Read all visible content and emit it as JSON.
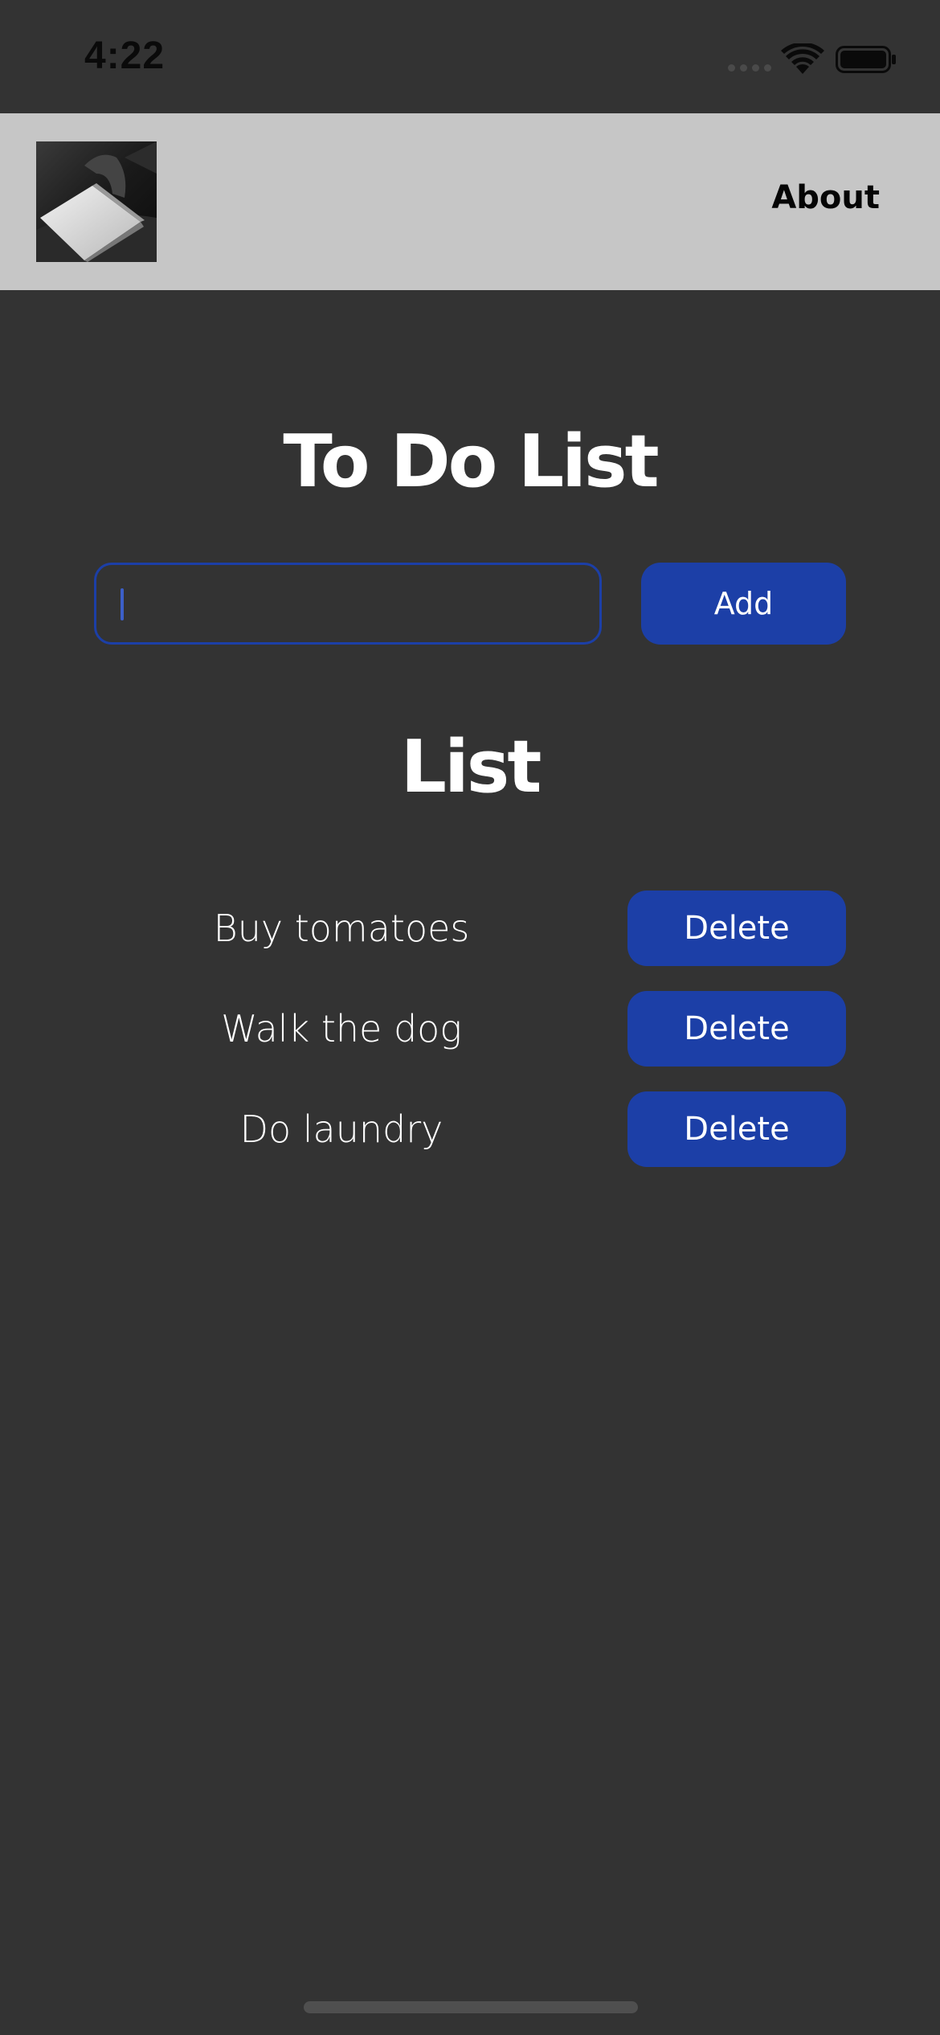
{
  "status_bar": {
    "time": "4:22",
    "icons": [
      "signal-icon",
      "wifi-icon",
      "battery-icon"
    ]
  },
  "nav": {
    "logo": "notebook-photo",
    "about_label": "About",
    "background": "#c6c6c6"
  },
  "main": {
    "title": "To Do List",
    "input": {
      "value": "",
      "placeholder": ""
    },
    "add_label": "Add",
    "list_heading": "List",
    "items": [
      {
        "text": "Buy tomatoes",
        "delete_label": "Delete"
      },
      {
        "text": "Walk the dog",
        "delete_label": "Delete"
      },
      {
        "text": "Do laundry",
        "delete_label": "Delete"
      }
    ]
  },
  "colors": {
    "background": "#333333",
    "accent": "#1c3fa7",
    "text": "#ffffff"
  }
}
